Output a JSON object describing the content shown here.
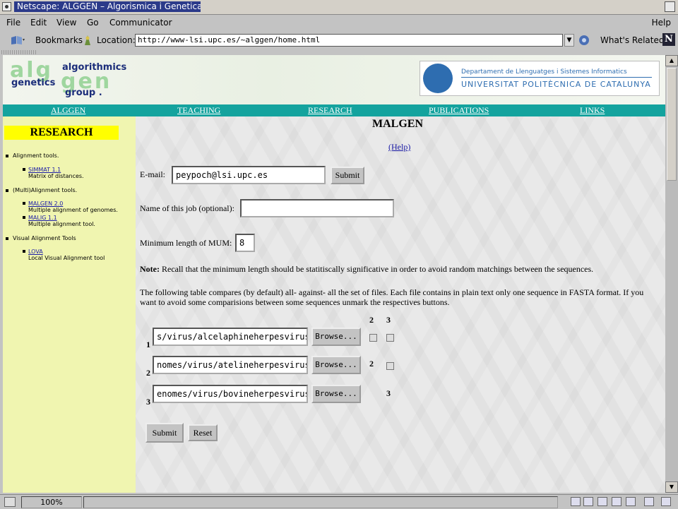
{
  "window": {
    "title": "Netscape: ALGGEN – Algorismica i Genetica"
  },
  "menu": [
    "File",
    "Edit",
    "View",
    "Go",
    "Communicator"
  ],
  "menu_help": "Help",
  "toolbar": {
    "bookmarks": "Bookmarks",
    "location_label": "Location:",
    "url": "http://www-lsi.upc.es/~alggen/home.html",
    "whats_related": "What's Related",
    "netscape_logo": "N"
  },
  "header": {
    "logo_a": "alg",
    "logo_b": "gen",
    "logo_words": [
      "algorithmics",
      "genetics",
      "group ."
    ],
    "dept": "Departament de Llenguatges i Sistemes Informatics",
    "university": "UNIVERSITAT POLITÈCNICA DE CATALUNYA"
  },
  "nav": [
    "ALGGEN",
    "TEACHING",
    "RESEARCH",
    "PUBLICATIONS",
    "LINKS"
  ],
  "sidebar": {
    "heading": "RESEARCH",
    "categories": [
      {
        "label": "Alignment tools.",
        "tools": [
          {
            "name": "SIMMAT 1.1",
            "desc": "Matrix of distances."
          }
        ]
      },
      {
        "label": "(Multi)Alignment tools.",
        "tools": [
          {
            "name": "MALGEN 2.0",
            "desc": "Multiple alignment of genomes."
          },
          {
            "name": "MALIG 1.1",
            "desc": "Multiple alignment tool."
          }
        ]
      },
      {
        "label": "Visual Alignment Tools",
        "tools": [
          {
            "name": "LOVA",
            "desc": "Local Visual Alignment tool"
          }
        ]
      }
    ]
  },
  "form": {
    "title": "MALGEN",
    "help": "(Help)",
    "email_label": "E-mail:",
    "email_value": "peypoch@lsi.upc.es",
    "email_submit": "Submit",
    "jobname_label": "Name of this job (optional):",
    "jobname_value": "",
    "minlen_label": "Minimum length of MUM:",
    "minlen_value": "8",
    "note_bold": "Note:",
    "note_text": " Recall that the minimum length should be statitiscally significative in order to avoid random matchings between the sequences.",
    "table_desc": "The following table compares (by default) all- against- all the set of files. Each file contains in plain text only one sequence in FASTA format. If you want to avoid some comparisions between some sequences unmark the respectives buttons.",
    "col_headers": [
      "2",
      "3"
    ],
    "rows": [
      {
        "num": "1",
        "file": "s/virus/alcelaphineherpesvirus",
        "browse": "Browse..."
      },
      {
        "num": "2",
        "file": "nomes/virus/atelineherpesvirus",
        "browse": "Browse...",
        "diag": "2"
      },
      {
        "num": "3",
        "file": "enomes/virus/bovineherpesvirus",
        "browse": "Browse...",
        "diag": "3"
      }
    ],
    "submit": "Submit",
    "reset": "Reset"
  },
  "status": {
    "zoom": "100%"
  }
}
